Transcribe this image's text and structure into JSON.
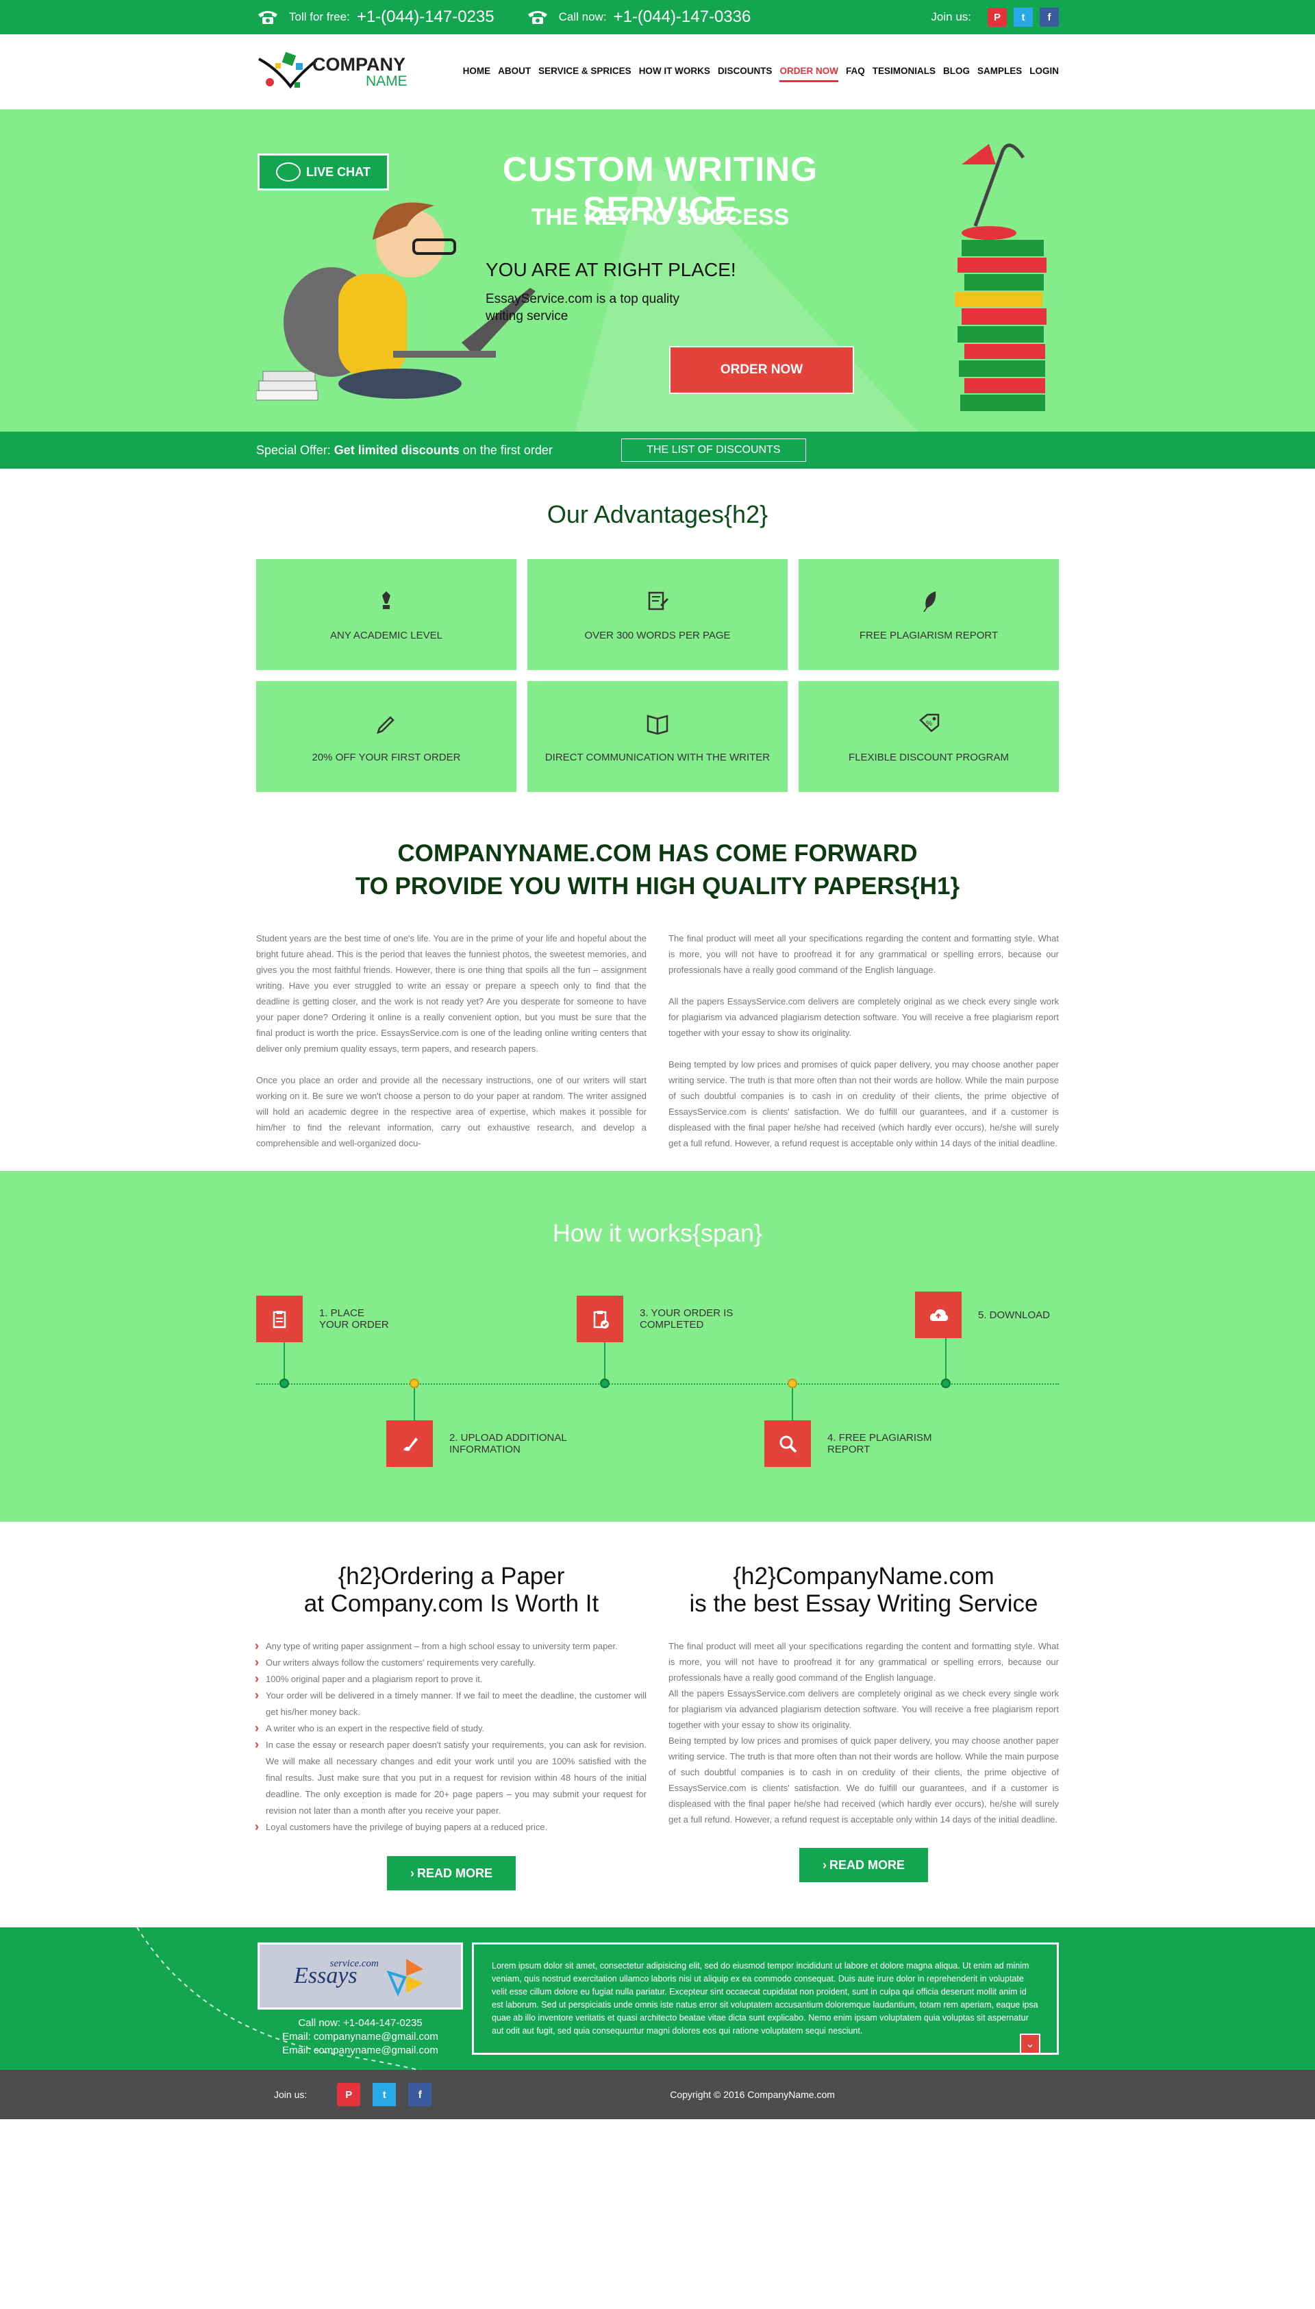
{
  "topbar": {
    "toll_label": "Toll for free:",
    "toll_number": "+1-(044)-147-0235",
    "call_label": "Call now:",
    "call_number": "+1-(044)-147-0336",
    "join_label": "Join us:",
    "social": [
      "pinterest-icon",
      "twitter-icon",
      "facebook-icon"
    ]
  },
  "logo": {
    "line1": "COMPANY",
    "line2": "NAME"
  },
  "nav": {
    "items": [
      "HOME",
      "ABOUT",
      "SERVICE & SPRICES",
      "HOW IT WORKS",
      "DISCOUNTS",
      "ORDER NOW",
      "FAQ",
      "TESIMONIALS",
      "BLOG",
      "SAMPLES",
      "LOGIN"
    ],
    "active": "ORDER NOW"
  },
  "hero": {
    "live_chat": "LIVE CHAT",
    "title": "CUSTOM WRITING SERVICE",
    "subtitle": "THE KEY TO SUCCESS",
    "tagline": "YOU ARE AT RIGHT PLACE!",
    "text": "EssayService.com is a top quality writing service",
    "order_button": "ORDER NOW"
  },
  "offer": {
    "prefix": "Special Offer:",
    "bold": "Get limited discounts",
    "suffix": "on the first order",
    "button": "THE LIST OF DISCOUNTS"
  },
  "advantages": {
    "title": "Our Advantages{h2}",
    "items": [
      {
        "label": "ANY ACADEMIC LEVEL",
        "icon": "pen-nib-icon"
      },
      {
        "label": "OVER 300 WORDS PER PAGE",
        "icon": "document-edit-icon"
      },
      {
        "label": "FREE PLAGIARISM REPORT",
        "icon": "quill-icon"
      },
      {
        "label": "20% OFF YOUR FIRST ORDER",
        "icon": "pencil-icon"
      },
      {
        "label": "DIRECT COMMUNICATION WITH THE WRITER",
        "icon": "open-book-icon"
      },
      {
        "label": "FLEXIBLE DISCOUNT PROGRAM",
        "icon": "discount-tag-icon"
      }
    ]
  },
  "forward": {
    "title_line1": "COMPANYNAME.COM HAS COME FORWARD",
    "title_line2": "TO PROVIDE YOU WITH HIGH QUALITY PAPERS{H1}",
    "left": [
      "Student years are the best time of one's life. You are in the prime of your life and hopeful about the bright future ahead. This is the period that leaves the funniest photos, the sweetest memories, and gives you the most faithful friends. However, there is one thing that spoils all the fun – assignment writing. Have you ever struggled to write an essay or prepare a speech only to find that the deadline is getting closer, and the work is not ready yet? Are you desperate for someone to have your paper done? Ordering it online is a really convenient option, but you must be sure that the final product is worth the price. EssaysService.com is one of the leading online writing centers that deliver only premium quality essays, term papers, and research papers.",
      "Once you place an order and provide all the necessary instructions, one of our writers will start working on it. Be sure we won't choose a person to do your paper at random. The writer assigned will hold an academic degree in the respective area of expertise, which makes it possible for him/her to find the relevant information, carry out exhaustive research, and develop a comprehensible and well-organized docu-"
    ],
    "right": [
      "The final product will meet all your specifications regarding the content and formatting style. What is more, you will not have to proofread it for any grammatical or spelling errors, because our professionals have a really good command of the English language.",
      "All the papers EssaysService.com delivers are completely original as we check every single work for plagiarism via advanced plagiarism detection software. You will receive a free plagiarism report together with your essay to show its originality.",
      "Being tempted by low prices and promises of quick paper delivery, you may choose another paper writing service. The truth is that more often than not their words are hollow. While the main purpose of such doubtful companies is to cash in on credulity of their clients, the prime objective of EssaysService.com is clients' satisfaction. We do fulfill our guarantees, and if a customer is displeased with the final paper he/she had received (which hardly ever occurs), he/she will surely get a full refund. However, a refund request is acceptable only within 14 days of the initial deadline."
    ]
  },
  "how": {
    "title": "How it works{span}",
    "steps": [
      {
        "line1": "1. PLACE",
        "line2": "YOUR ORDER",
        "icon": "clipboard-icon"
      },
      {
        "line1": "2. UPLOAD ADDITIONAL",
        "line2": "INFORMATION",
        "icon": "brush-icon"
      },
      {
        "line1": "3. YOUR ORDER IS",
        "line2": "COMPLETED",
        "icon": "clipboard-check-icon"
      },
      {
        "line1": "4. FREE PLAGIARISM",
        "line2": "REPORT",
        "icon": "magnifier-icon"
      },
      {
        "line1": "5. DOWNLOAD",
        "line2": "",
        "icon": "cloud-upload-icon"
      }
    ]
  },
  "ordering": {
    "title_line1": "{h2}Ordering a Paper",
    "title_line2": "at Company.com Is Worth It",
    "items": [
      "Any type of writing paper assignment – from a high school essay to university term paper.",
      "Our writers always follow the customers' requirements very carefully.",
      "100% original paper and a plagiarism report to prove it.",
      "Your order will be delivered in a timely manner. If we fail to meet the deadline, the customer will get his/her money back.",
      "A writer who is an expert in the respective field of study.",
      "In case the essay or research paper doesn't satisfy your requirements, you can ask for revision. We will make all necessary changes and edit your work until you are 100% satisfied with the final results. Just make sure that you put in a request for revision within 48 hours of the initial deadline. The only exception is made for 20+ page papers – you may submit your request for revision not later than a month after you receive your paper.",
      "Loyal customers have the privilege of buying papers at a reduced price."
    ],
    "button": "READ MORE"
  },
  "best": {
    "title_line1": "{h2}CompanyName.com",
    "title_line2": "is the best Essay Writing Service",
    "text": [
      "The final product will meet all your specifications regarding the content and formatting style. What is more, you will not have to proofread it for any grammatical or spelling errors, because our professionals have a really good command of the English language.",
      "All the papers EssaysService.com delivers are completely original as we check every single work for plagiarism via advanced plagiarism detection software. You will receive a free plagiarism report together with your essay to show its originality.",
      "Being tempted by low prices and promises of quick paper delivery, you may choose another paper writing service. The truth is that more often than not their words are hollow. While the main purpose of such doubtful companies is to cash in on credulity of their clients, the prime objective of EssaysService.com is clients' satisfaction. We do fulfill our guarantees, and if a customer is displeased with the final paper he/she had received (which hardly ever occurs), he/she will surely get a full refund. However, a refund request is acceptable only within 14 days of the initial deadline."
    ],
    "button": "READ MORE"
  },
  "footer": {
    "logo_small": "service.com",
    "logo_main": "Essays",
    "call": "Call now: +1-044-147-0235",
    "email1": "Email: companyname@gmail.com",
    "email2": "Email: companyname@gmail.com",
    "lorem": "Lorem ipsum dolor sit amet, consectetur adipisicing elit, sed do eiusmod tempor incididunt ut labore et dolore magna aliqua. Ut enim ad minim veniam, quis nostrud exercitation ullamco laboris nisi ut aliquip ex ea commodo consequat. Duis aute irure dolor in reprehenderit in voluptate velit esse cillum dolore eu fugiat nulla pariatur. Excepteur sint occaecat cupidatat non proident, sunt in culpa qui officia deserunt mollit anim id est laborum. Sed ut perspiciatis unde omnis iste natus error sit voluptatem accusantium doloremque laudantium, totam rem aperiam, eaque ipsa quae ab illo inventore veritatis et quasi architecto beatae vitae dicta sunt explicabo. Nemo enim ipsam voluptatem quia voluptas sit aspernatur aut odit aut fugit, sed quia consequuntur magni dolores eos qui ratione voluptatem sequi nesciunt.",
    "join_label": "Join us:",
    "copyright": "Copyright © 2016 CompanyName.com"
  },
  "colors": {
    "primary_green": "#14a551",
    "light_green": "#85ec8c",
    "accent_red": "#e4433b",
    "dark_footer": "#4d4d4d"
  }
}
